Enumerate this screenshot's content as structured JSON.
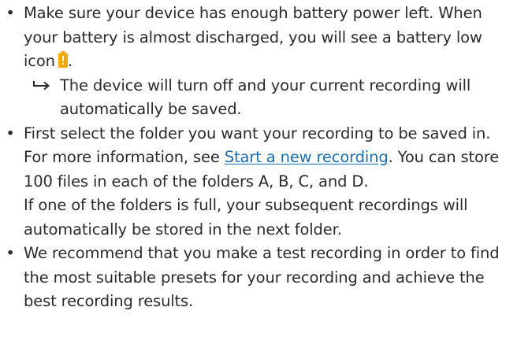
{
  "items": [
    {
      "text_before_icon": "Make sure your device has enough battery power left. When your battery is almost discharged, you will see a battery low icon",
      "text_after_icon": ".",
      "icon": "battery-low-icon",
      "icon_color": "#f5a800",
      "result": "The device will turn off and your current recording will automatically be saved."
    },
    {
      "text_before_link": "First select the folder you want your recording to be saved in. For more information, see ",
      "link_text": "Start a new recording",
      "text_after_link": ". You can store 100 files in each of the folders A, B, C, and D.",
      "paragraph_2": "If one of the folders is full, your subsequent recordings will automatically be stored in the next folder."
    },
    {
      "text": "We recommend that you make a test recording in order to find the most suitable presets for your recording and achieve the best recording results."
    }
  ],
  "colors": {
    "text": "#2b2b2b",
    "link": "#1a6fb3",
    "battery": "#f5a800"
  },
  "bullet_glyph": "•",
  "arrow_icon": "result-arrow-icon"
}
